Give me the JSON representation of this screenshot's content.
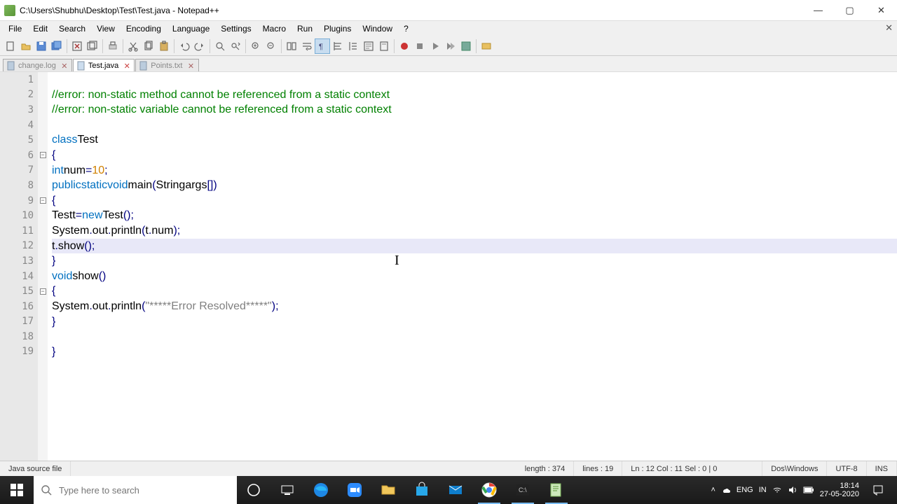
{
  "title": "C:\\Users\\Shubhu\\Desktop\\Test\\Test.java - Notepad++",
  "menu": [
    "File",
    "Edit",
    "Search",
    "View",
    "Encoding",
    "Language",
    "Settings",
    "Macro",
    "Run",
    "Plugins",
    "Window",
    "?"
  ],
  "tabs": [
    {
      "label": "change.log",
      "active": false
    },
    {
      "label": "Test.java",
      "active": true
    },
    {
      "label": "Points.txt",
      "active": false
    }
  ],
  "code_lines": [
    {
      "n": 1,
      "raw": ""
    },
    {
      "n": 2,
      "raw": "//error: non-static method cannot be referenced from a static context"
    },
    {
      "n": 3,
      "raw": "//error: non-static variable cannot be referenced from a static context"
    },
    {
      "n": 4,
      "raw": ""
    },
    {
      "n": 5,
      "raw": "class Test"
    },
    {
      "n": 6,
      "raw": "{"
    },
    {
      "n": 7,
      "raw": "    int num = 10;"
    },
    {
      "n": 8,
      "raw": "    public static void main(String args[])"
    },
    {
      "n": 9,
      "raw": "    {"
    },
    {
      "n": 10,
      "raw": "        Test t = new Test();"
    },
    {
      "n": 11,
      "raw": "        System.out.println(t.num);"
    },
    {
      "n": 12,
      "raw": "        t.show();"
    },
    {
      "n": 13,
      "raw": "    }"
    },
    {
      "n": 14,
      "raw": "    void show()"
    },
    {
      "n": 15,
      "raw": "    {"
    },
    {
      "n": 16,
      "raw": "        System.out.println(\"*****Error Resolved*****\");"
    },
    {
      "n": 17,
      "raw": "    }"
    },
    {
      "n": 18,
      "raw": ""
    },
    {
      "n": 19,
      "raw": "}"
    }
  ],
  "current_line": 12,
  "caret_col": 11,
  "status": {
    "filetype": "Java source file",
    "length_label": "length : 374",
    "lines_label": "lines : 19",
    "pos_label": "Ln : 12    Col : 11    Sel : 0 | 0",
    "eol": "Dos\\Windows",
    "encoding": "UTF-8",
    "mode": "INS"
  },
  "search_placeholder": "Type here to search",
  "tray": {
    "lang1": "ENG",
    "lang2": "IN",
    "time": "18:14",
    "date": "27-05-2020"
  },
  "icon_colors": {
    "edge": "#1e88e5",
    "chrome": "#ea4335",
    "skype": "#0f7ecc",
    "folder": "#f2c85c",
    "store": "#28a8ea",
    "mail": "#0f7ecc",
    "cmd": "#222",
    "npp": "#7fb85c"
  }
}
